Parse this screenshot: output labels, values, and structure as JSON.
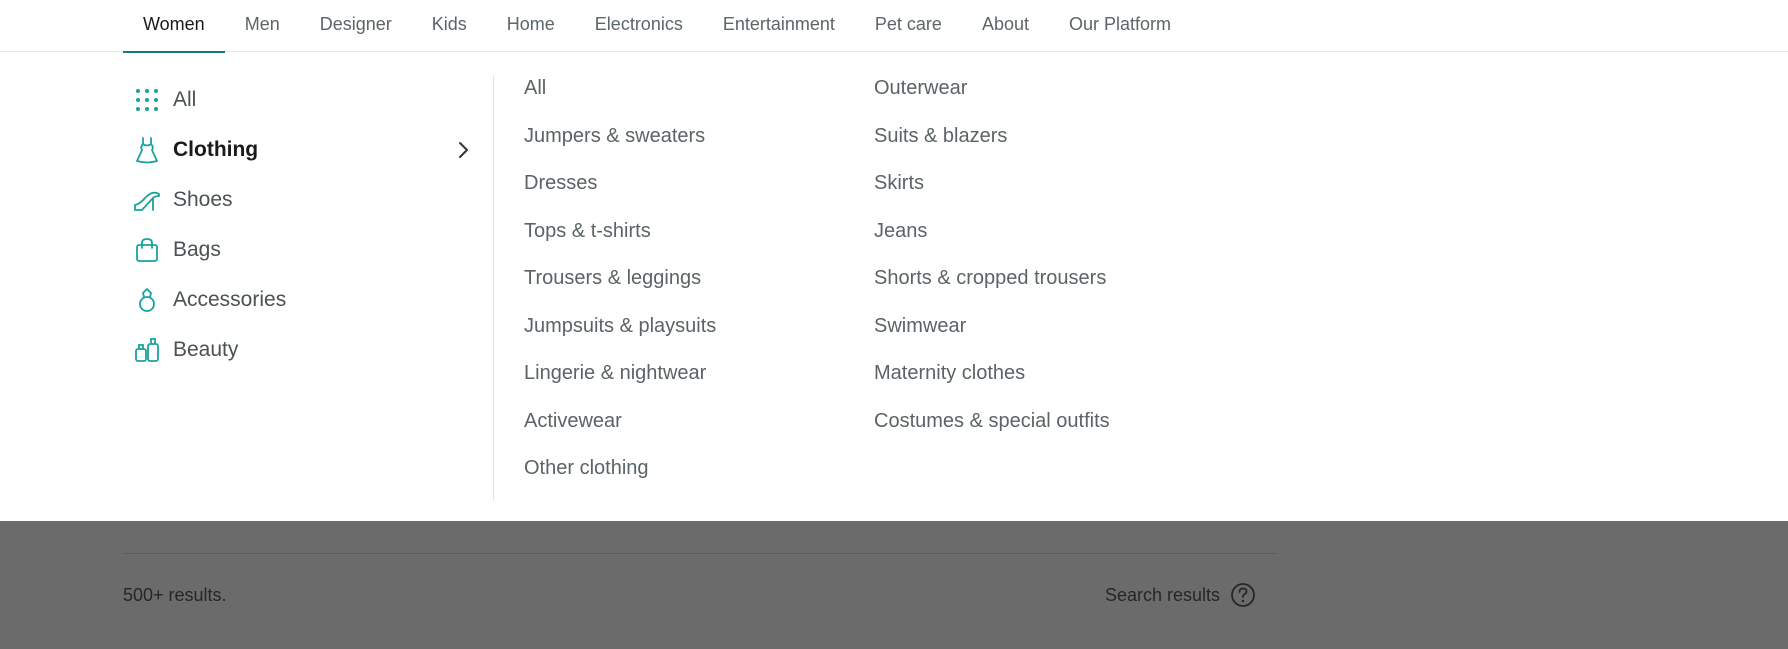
{
  "nav": {
    "tabs": [
      {
        "label": "Women",
        "active": true
      },
      {
        "label": "Men"
      },
      {
        "label": "Designer"
      },
      {
        "label": "Kids"
      },
      {
        "label": "Home"
      },
      {
        "label": "Electronics"
      },
      {
        "label": "Entertainment"
      },
      {
        "label": "Pet care"
      },
      {
        "label": "About"
      },
      {
        "label": "Our Platform"
      }
    ]
  },
  "categories": [
    {
      "label": "All",
      "icon": "grid-icon"
    },
    {
      "label": "Clothing",
      "icon": "dress-icon",
      "active": true
    },
    {
      "label": "Shoes",
      "icon": "heel-shoe-icon"
    },
    {
      "label": "Bags",
      "icon": "bag-icon"
    },
    {
      "label": "Accessories",
      "icon": "ring-icon"
    },
    {
      "label": "Beauty",
      "icon": "beauty-icon"
    }
  ],
  "subcategories": {
    "column1": [
      "All",
      "Jumpers & sweaters",
      "Dresses",
      "Tops & t-shirts",
      "Trousers & leggings",
      "Jumpsuits & playsuits",
      "Lingerie & nightwear",
      "Activewear",
      "Other clothing"
    ],
    "column2": [
      "Outerwear",
      "Suits & blazers",
      "Skirts",
      "Jeans",
      "Shorts & cropped trousers",
      "Swimwear",
      "Maternity clothes",
      "Costumes & special outfits"
    ]
  },
  "results": {
    "count": "500+ results.",
    "search_results_label": "Search results"
  },
  "colors": {
    "accent": "#127a80",
    "icon_teal": "#1aa39c",
    "overlay": "#6b6b6b"
  }
}
